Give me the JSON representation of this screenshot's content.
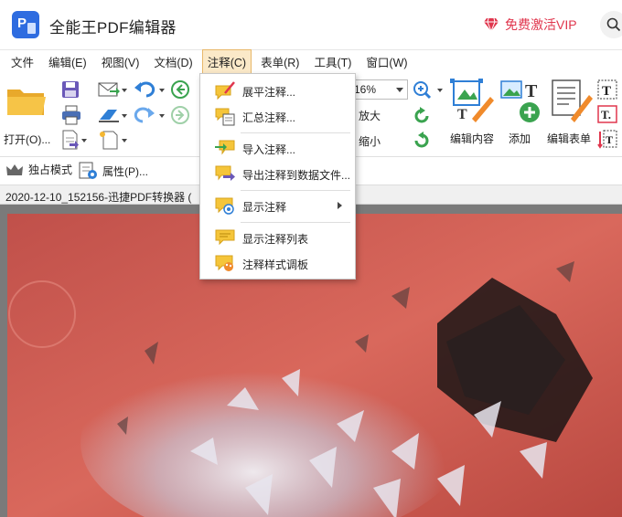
{
  "window": {
    "app_title": "全能王PDF编辑器",
    "vip_label": "免费激活VIP",
    "colors": {
      "accent": "#2e6ce0",
      "vip": "#e0364d",
      "menu_active_bg": "#fbe9c8"
    }
  },
  "menubar": {
    "items": [
      "文件",
      "编辑(E)",
      "视图(V)",
      "文档(D)",
      "注释(C)",
      "表单(R)",
      "工具(T)",
      "窗口(W)"
    ],
    "active": "注释(C)"
  },
  "toolbar": {
    "open_label": "打开(O)...",
    "zoom_value": "16%",
    "zoom_in_label": "放大",
    "zoom_out_label": "缩小",
    "edit_content_label": "编辑内容",
    "add_label": "添加",
    "edit_form_label": "编辑表单"
  },
  "subbar": {
    "exclusive_mode_label": "独占模式",
    "properties_label": "属性(P)..."
  },
  "document": {
    "tab_title": "2020-12-10_152156-迅捷PDF转换器 ("
  },
  "dropdown": {
    "items": [
      {
        "label": "展平注释...",
        "icon": "flatten-annotation-icon"
      },
      {
        "label": "汇总注释...",
        "icon": "summarize-annotation-icon"
      },
      {
        "label": "导入注释...",
        "icon": "import-annotation-icon"
      },
      {
        "label": "导出注释到数据文件...",
        "icon": "export-annotation-icon"
      },
      {
        "label": "显示注释",
        "icon": "show-annotation-icon",
        "has_submenu": true
      },
      {
        "label": "显示注释列表",
        "icon": "annotation-list-icon"
      },
      {
        "label": "注释样式调板",
        "icon": "annotation-style-icon"
      }
    ]
  }
}
